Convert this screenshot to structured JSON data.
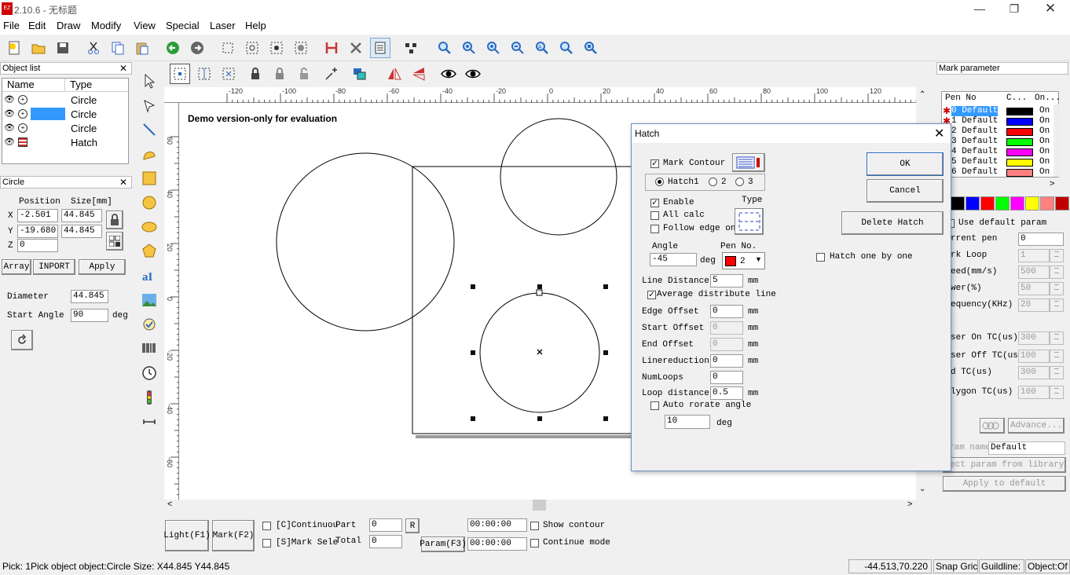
{
  "window": {
    "title": "2.10.6 - 无标题",
    "app_icon": "ezcad-icon"
  },
  "menu": [
    "File",
    "Edit",
    "Draw",
    "Modify",
    "View",
    "Special",
    "Laser",
    "Help"
  ],
  "object_list": {
    "title": "Object list",
    "col_name": "Name",
    "col_type": "Type",
    "rows": [
      {
        "type": "Circle",
        "selected": false
      },
      {
        "type": "Circle",
        "selected": true
      },
      {
        "type": "Circle",
        "selected": false
      },
      {
        "type": "Hatch",
        "selected": false
      }
    ]
  },
  "circle_panel": {
    "title": "Circle",
    "position_label": "Position",
    "size_label": "Size[mm]",
    "x_label": "X",
    "y_label": "Y",
    "z_label": "Z",
    "x_pos": "-2.501",
    "x_size": "44.845",
    "y_pos": "-19.680",
    "y_size": "44.845",
    "z_pos": "0",
    "array_btn": "Array",
    "inport_btn": "INPORT",
    "apply_btn": "Apply",
    "diameter_label": "Diameter",
    "diameter": "44.845",
    "start_angle_label": "Start Angle",
    "start_angle": "90",
    "deg": "deg"
  },
  "canvas": {
    "watermark": "Demo version-only for evaluation",
    "h_ticks": [
      "-120",
      "-100",
      "-80",
      "-60",
      "-40",
      "-20",
      "0",
      "20",
      "40",
      "60",
      "80",
      "100",
      "120"
    ],
    "v_ticks": [
      "60",
      "40",
      "20",
      "0",
      "-20",
      "-40",
      "-60"
    ]
  },
  "bottom": {
    "light_btn": "Light(F1)",
    "mark_btn": "Mark(F2)",
    "continuous": "[C]Continuou",
    "mark_sel": "[S]Mark Sele",
    "part_label": "Part",
    "part_val": "0",
    "total_label": "Total",
    "total_val": "0",
    "r_btn": "R",
    "time1": "00:00:00",
    "time2": "00:00:00",
    "param_btn": "Param(F3)",
    "show_contour": "Show contour",
    "continue_mode": "Continue mode"
  },
  "hatch": {
    "title": "Hatch",
    "mark_contour": "Mark Contour",
    "hatch1": "Hatch1",
    "hatch2": "2",
    "hatch3": "3",
    "enable": "Enable",
    "all_calc": "All calc",
    "follow_edge": "Follow edge on",
    "type_label": "Type",
    "angle_label": "Angle",
    "angle": "-45",
    "deg": "deg",
    "pen_no_label": "Pen No.",
    "pen_no": "2",
    "pen_color": "#ff0000",
    "line_distance_label": "Line Distance",
    "line_distance": "5",
    "mm": "mm",
    "average_distribute": "Average distribute line",
    "edge_offset_label": "Edge Offset",
    "edge_offset": "0",
    "start_offset_label": "Start Offset",
    "start_offset": "0",
    "end_offset_label": "End Offset",
    "end_offset": "0",
    "linereduction_label": "Linereduction",
    "linereduction": "0",
    "numloops_label": "NumLoops",
    "numloops": "0",
    "loop_distance_label": "Loop distance",
    "loop_distance": "0.5",
    "auto_rotate": "Auto rorate angle",
    "auto_rotate_val": "10",
    "ok_btn": "OK",
    "cancel_btn": "Cancel",
    "delete_btn": "Delete Hatch",
    "hatch_one": "Hatch one by one"
  },
  "mark_param": {
    "title": "Mark parameter",
    "col_pen": "Pen No",
    "col_color": "C...",
    "col_on": "On...",
    "pens": [
      {
        "name": "0 Default",
        "color": "#000000",
        "on": "On"
      },
      {
        "name": "1 Default",
        "color": "#0000ff",
        "on": "On"
      },
      {
        "name": "2 Default",
        "color": "#ff0000",
        "on": "On"
      },
      {
        "name": "3 Default",
        "color": "#00ff00",
        "on": "On"
      },
      {
        "name": "4 Default",
        "color": "#ff00ff",
        "on": "On"
      },
      {
        "name": "5 Default",
        "color": "#ffff00",
        "on": "On"
      },
      {
        "name": "6 Default",
        "color": "#ff8080",
        "on": "On"
      }
    ],
    "palette": [
      "#000000",
      "#0000ff",
      "#ff0000",
      "#00ff00",
      "#ff00ff",
      "#ffff00",
      "#ff8080",
      "#c00000"
    ],
    "use_default": "Use default param",
    "current_pen_label": "rrent pen",
    "current_pen": "0",
    "loop_label": "rk Loop",
    "loop": "1",
    "speed_label": "eed(mm/s)",
    "speed": "500",
    "power_label": "wer(%)",
    "power": "50",
    "freq_label": "equency(KHz)",
    "freq": "20",
    "laser_on_label": "ser On TC(us)",
    "laser_on": "300",
    "laser_off_label": "ser Off TC(us)",
    "laser_off": "100",
    "end_tc_label": "d TC(us)",
    "end_tc": "300",
    "polygon_label": "lygon TC(us)",
    "polygon": "100",
    "advance_btn": "Advance...",
    "param_name_label": "ram name",
    "param_name": "Default",
    "select_lib_btn": "lect param from library",
    "apply_default_btn": "Apply to default"
  },
  "status": {
    "message": "Pick: 1Pick object object:Circle Size: X44.845 Y44.845",
    "coords": "-44.513,70.220",
    "snap": "Snap Gric",
    "guidline": "Guildline:",
    "object": "Object:Of"
  }
}
